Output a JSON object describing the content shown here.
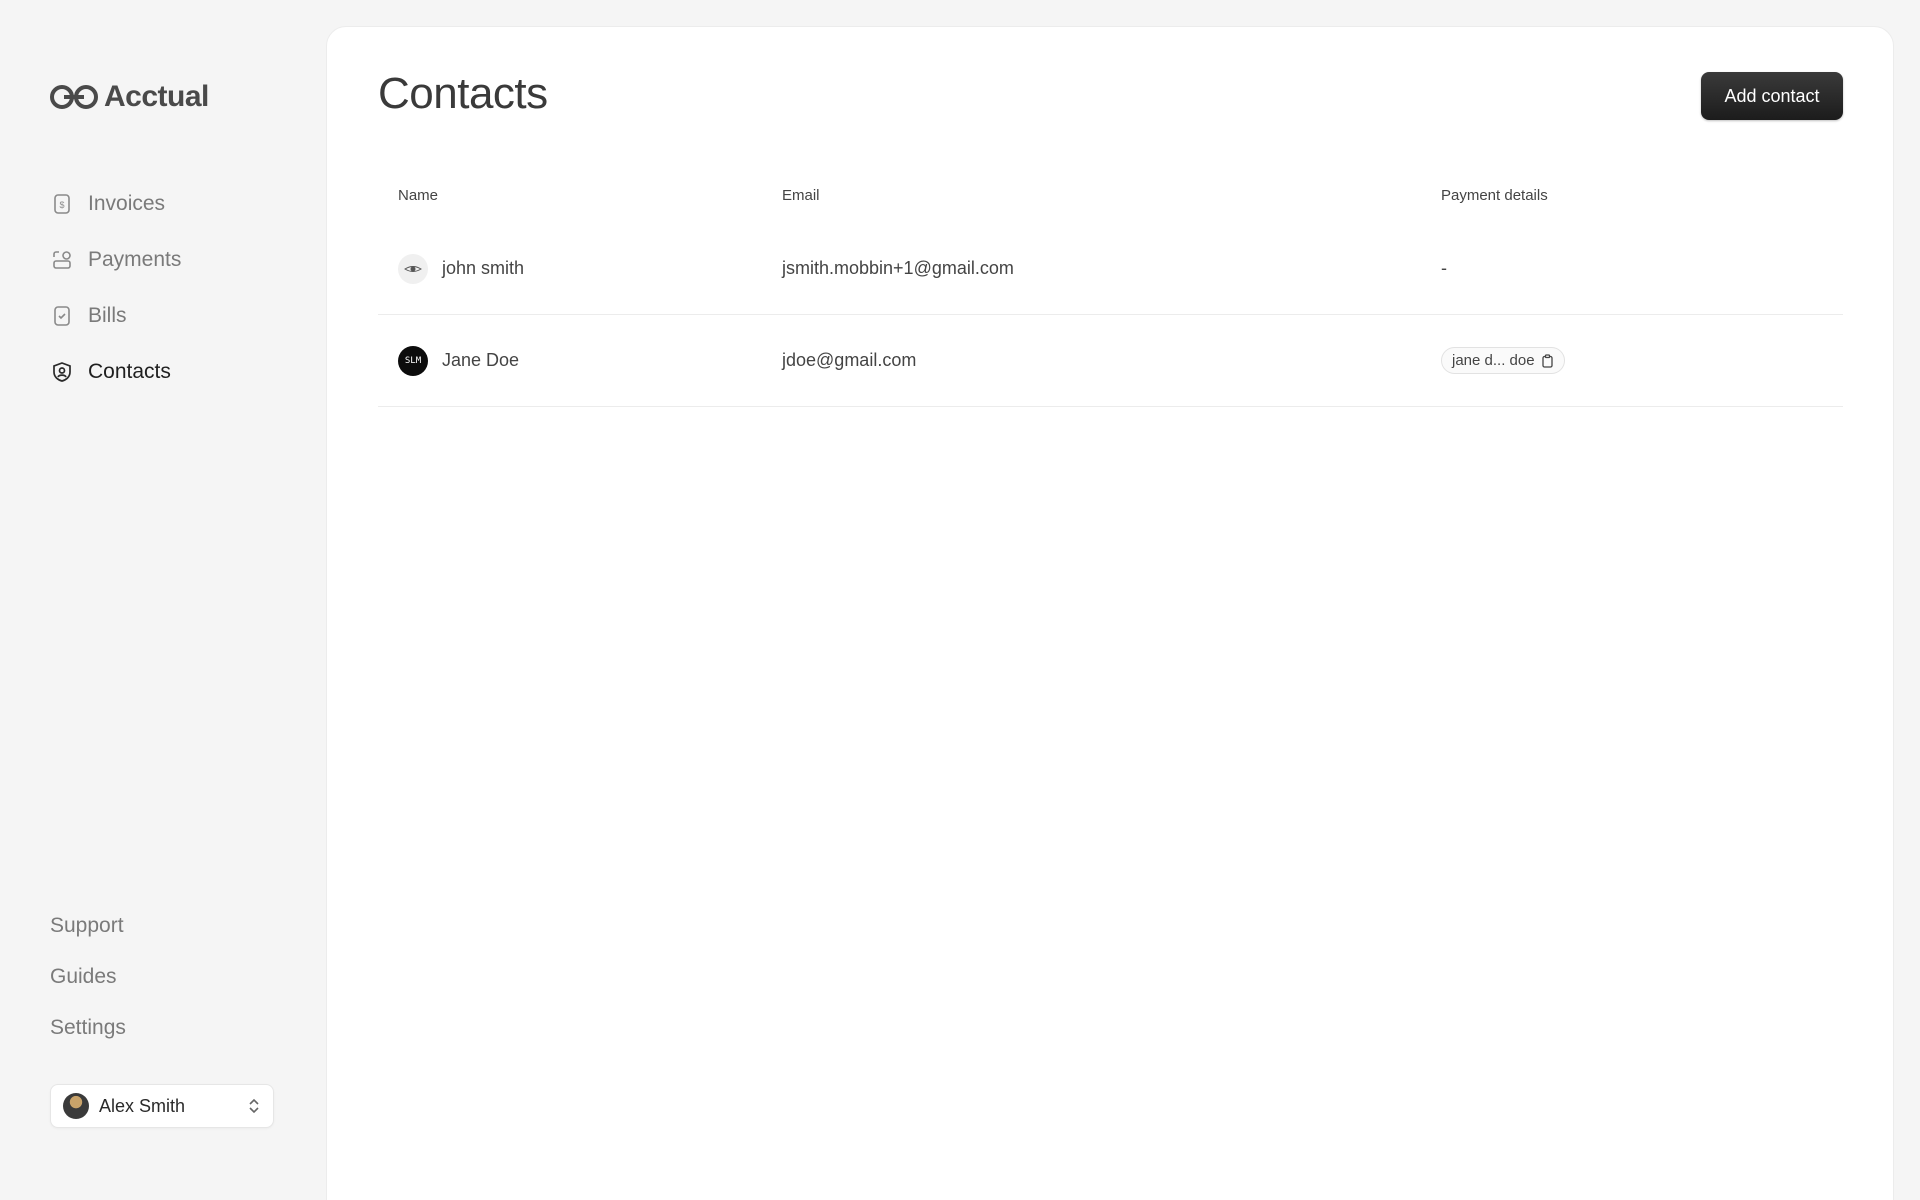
{
  "brand": {
    "name": "Acctual"
  },
  "sidebar": {
    "items": [
      {
        "label": "Invoices",
        "icon": "invoice-icon",
        "active": false
      },
      {
        "label": "Payments",
        "icon": "payments-icon",
        "active": false
      },
      {
        "label": "Bills",
        "icon": "bill-icon",
        "active": false
      },
      {
        "label": "Contacts",
        "icon": "contact-icon",
        "active": true
      }
    ],
    "secondary": [
      {
        "label": "Support"
      },
      {
        "label": "Guides"
      },
      {
        "label": "Settings"
      }
    ],
    "user": {
      "name": "Alex Smith",
      "avatar_icon": "user-avatar"
    }
  },
  "main": {
    "title": "Contacts",
    "add_button": "Add contact",
    "table": {
      "headers": {
        "name": "Name",
        "email": "Email",
        "payment": "Payment details"
      },
      "rows": [
        {
          "name": "john smith",
          "email": "jsmith.mobbin+1@gmail.com",
          "payment": "-",
          "avatar_style": "light"
        },
        {
          "name": "Jane Doe",
          "email": "jdoe@gmail.com",
          "payment": "jane d... doe",
          "avatar_text": "SLM",
          "avatar_style": "dark"
        }
      ]
    }
  },
  "colors": {
    "background": "#f5f5f5",
    "panel": "#ffffff",
    "button": "#1f1f1f",
    "text_muted": "#7a7a7a",
    "text_active": "#1f1f1f"
  }
}
